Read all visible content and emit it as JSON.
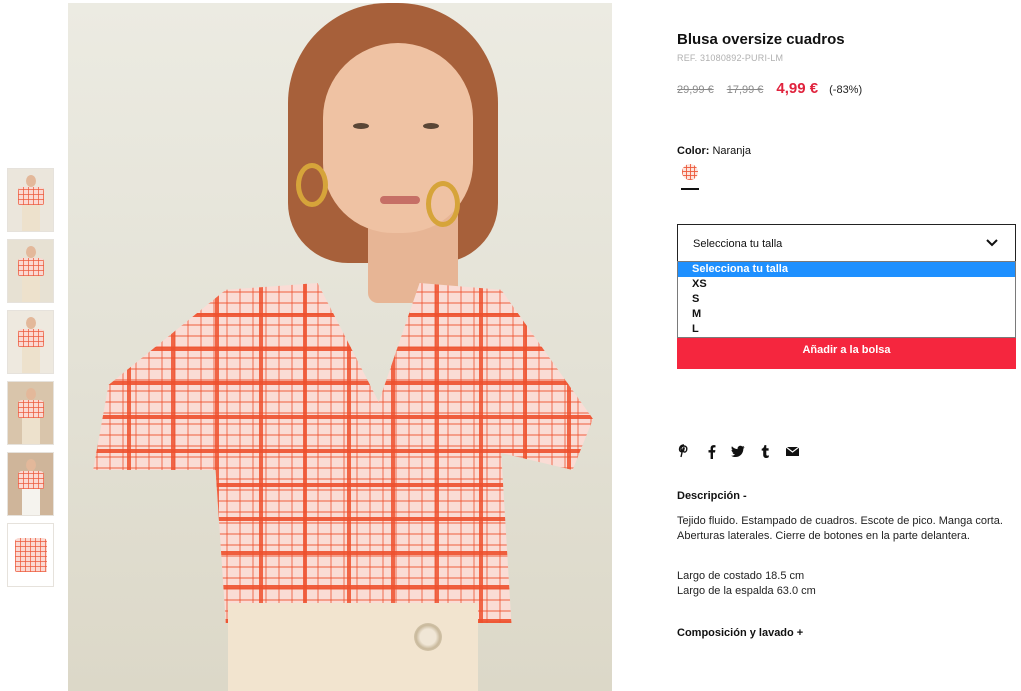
{
  "thumbnails": [
    {
      "name": "thumbnail-1",
      "bg": "#ebe6dc"
    },
    {
      "name": "thumbnail-2",
      "bg": "#e7e1d3"
    },
    {
      "name": "thumbnail-3",
      "bg": "#eee9df"
    },
    {
      "name": "thumbnail-4",
      "bg": "#d9c5ab"
    },
    {
      "name": "thumbnail-5",
      "bg": "#cfb59a"
    },
    {
      "name": "thumbnail-6",
      "bg": "#ffffff"
    }
  ],
  "product": {
    "title": "Blusa oversize cuadros",
    "ref": "REF. 31080892-PURI-LM",
    "price_original": "29,99 €",
    "price_previous": "17,99 €",
    "price_sale": "4,99 €",
    "discount": "(-83%)",
    "color_label": "Color:",
    "color_value": "Naranja"
  },
  "size_select": {
    "selected": "Selecciona tu talla",
    "options": [
      "Selecciona tu talla",
      "XS",
      "S",
      "M",
      "L"
    ]
  },
  "add_to_bag": "Añadir a la bolsa",
  "share_icons": [
    "pinterest-icon",
    "facebook-icon",
    "twitter-icon",
    "tumblr-icon",
    "mail-icon"
  ],
  "description": {
    "heading": "Descripción -",
    "text": "Tejido fluido. Estampado de cuadros. Escote de pico. Manga corta. Aberturas laterales. Cierre de botones en la parte delantera.",
    "measure_1": "Largo de costado 18.5 cm",
    "measure_2": "Largo de la espalda 63.0 cm"
  },
  "composition": {
    "heading": "Composición y lavado +"
  },
  "colors": {
    "sale": "#e0233d",
    "add_button": "#f5263e",
    "selected_option": "#1e90ff"
  }
}
